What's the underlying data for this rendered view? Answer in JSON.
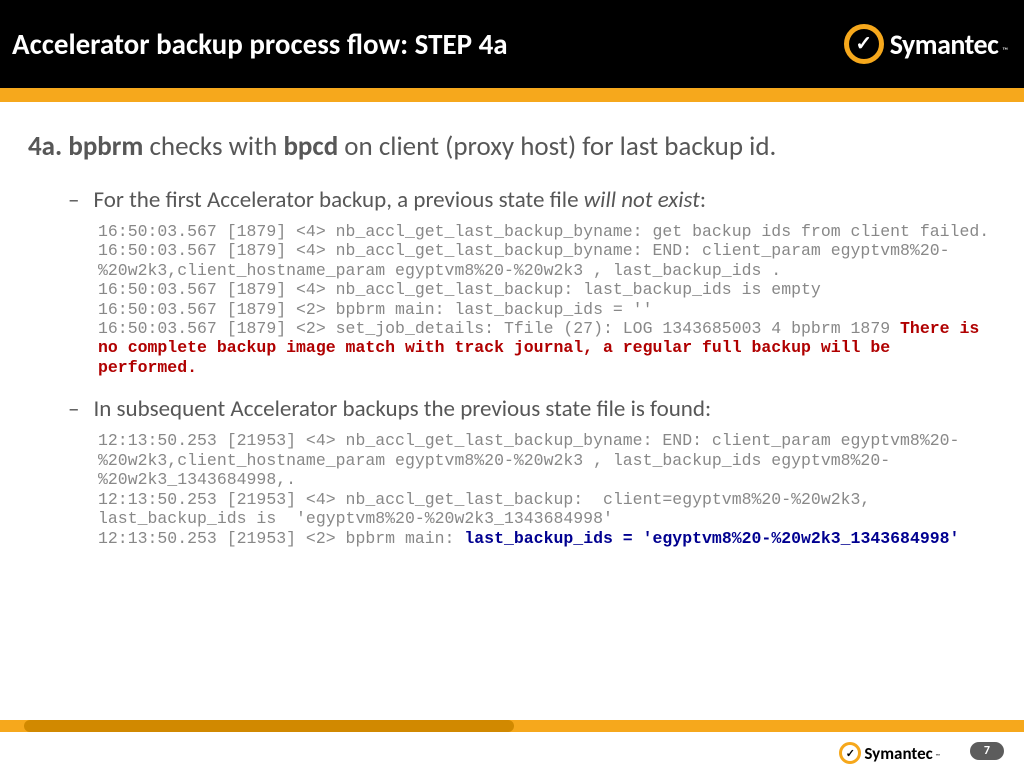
{
  "header": {
    "title": "Accelerator backup process flow: STEP 4a",
    "brand": "Symantec"
  },
  "lead": {
    "prefix": "4a. bpbrm",
    "mid1": " checks with ",
    "bold2": "bpcd",
    "suffix": " on client (proxy host) for last backup id."
  },
  "b1": {
    "pre": "For the first Accelerator backup, a previous state file ",
    "em": "will not exist",
    "post": ":"
  },
  "log1": {
    "gray": "16:50:03.567 [1879] <4> nb_accl_get_last_backup_byname: get backup ids from client failed.\n16:50:03.567 [1879] <4> nb_accl_get_last_backup_byname: END: client_param egyptvm8%20-%20w2k3,client_hostname_param egyptvm8%20-%20w2k3 , last_backup_ids .\n16:50:03.567 [1879] <4> nb_accl_get_last_backup: last_backup_ids is empty\n16:50:03.567 [1879] <2> bpbrm main: last_backup_ids = ''\n16:50:03.567 [1879] <2> set_job_details: Tfile (27): LOG 1343685003 4 bpbrm 1879 ",
    "red": "There is no complete backup image match with track journal, a regular full backup will be performed."
  },
  "b2": {
    "text": "In subsequent Accelerator backups the previous state file is found:"
  },
  "log2": {
    "gray": "12:13:50.253 [21953] <4> nb_accl_get_last_backup_byname: END: client_param egyptvm8%20-%20w2k3,client_hostname_param egyptvm8%20-%20w2k3 , last_backup_ids egyptvm8%20-%20w2k3_1343684998,.\n12:13:50.253 [21953] <4> nb_accl_get_last_backup:  client=egyptvm8%20-%20w2k3, last_backup_ids is  'egyptvm8%20-%20w2k3_1343684998'\n12:13:50.253 [21953] <2> bpbrm main: ",
    "blue": "last_backup_ids = 'egyptvm8%20-%20w2k3_1343684998'"
  },
  "footer": {
    "brand": "Symantec",
    "page": "7"
  }
}
